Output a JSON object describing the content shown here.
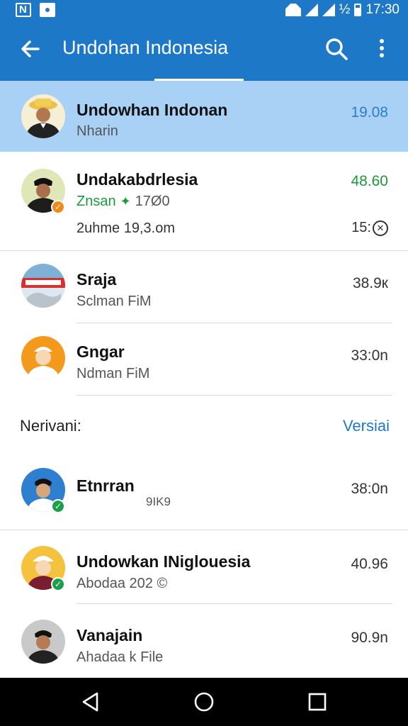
{
  "status_bar": {
    "time": "17:30",
    "network": "½"
  },
  "app_bar": {
    "title": "Undohan Indonesia"
  },
  "rows": [
    {
      "name": "Undowhan Indonan",
      "subtitle": "Nharin",
      "time": "19.08"
    },
    {
      "name": "Undakabdrlesia",
      "subtitle": "Znsan",
      "subtitle_extra": "17Ø0",
      "line3": "2uhme 19,3.om",
      "time": "48.60",
      "meta2": "15:"
    },
    {
      "name": "Sraja",
      "subtitle": "Sclman FiM",
      "time": "38.9к"
    },
    {
      "name": "Gngar",
      "subtitle": "Ndman FiM",
      "time": "33:0n"
    }
  ],
  "section": {
    "label": "Nerivani:",
    "action": "Versiai"
  },
  "rows2": [
    {
      "name": "Etnrran",
      "subtitle": "9IK9",
      "time": "38:0n"
    },
    {
      "name": "Undowkan INiglouesia",
      "subtitle": "Abodaa 202 ©",
      "time": "40.96"
    },
    {
      "name": "Vanajain",
      "subtitle": "Ahadaa k File",
      "time": "90.9n"
    }
  ],
  "colors": {
    "primary": "#1e78c8",
    "selected": "#a9d1f5",
    "accent_green": "#1a9a3a"
  }
}
